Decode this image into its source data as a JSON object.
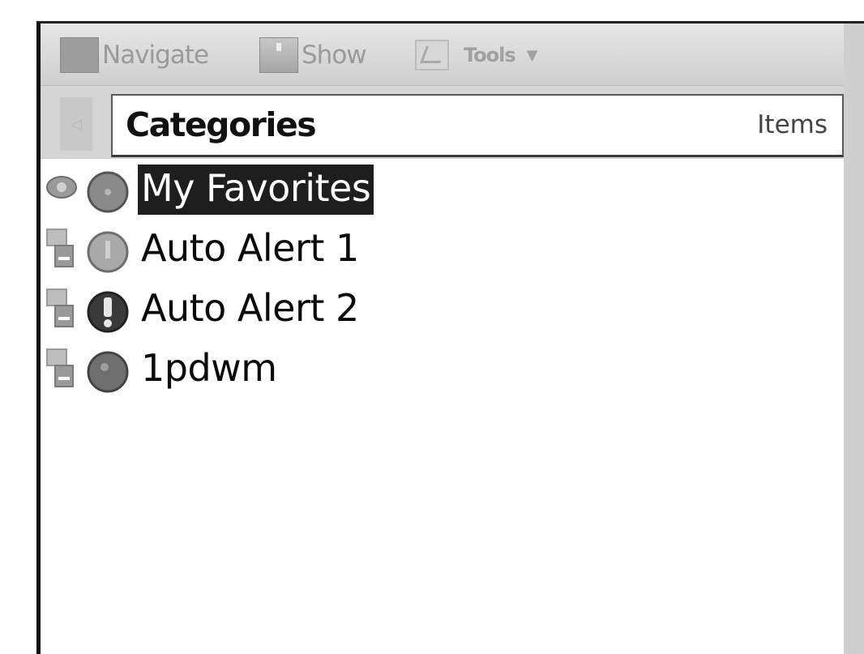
{
  "toolbar": {
    "navigate_label": "Navigate",
    "show_label": "Show",
    "tools_label": "Tools",
    "tools_arrow": "▼"
  },
  "header": {
    "back_glyph": "◁",
    "title": "Categories",
    "items_label": "Items"
  },
  "list": {
    "items": [
      {
        "label": "My Favorites",
        "selected": true,
        "icon1": "favorites-eye-icon",
        "icon2": "gray-circle-icon"
      },
      {
        "label": "Auto Alert 1",
        "selected": false,
        "icon1": "alert-document-icon",
        "icon2": "info-circle-icon"
      },
      {
        "label": "Auto Alert 2",
        "selected": false,
        "icon1": "alert-document-icon",
        "icon2": "exclamation-circle-icon"
      },
      {
        "label": "1pdwm",
        "selected": false,
        "icon1": "alert-document-icon",
        "icon2": "gray-circle-icon"
      }
    ]
  },
  "colors": {
    "toolbar_bg": "#d6d6d6",
    "selected_bg": "#1e1e1e",
    "selected_text": "#ffffff",
    "frame_border": "#111111"
  }
}
